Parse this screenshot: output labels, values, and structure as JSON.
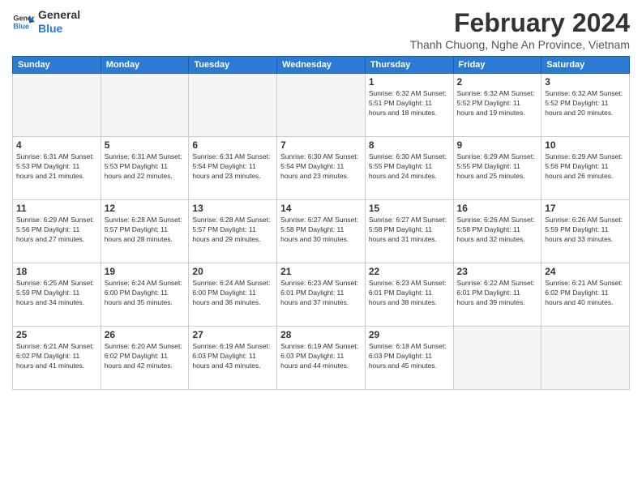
{
  "logo": {
    "line1": "General",
    "line2": "Blue"
  },
  "title": "February 2024",
  "subtitle": "Thanh Chuong, Nghe An Province, Vietnam",
  "days_of_week": [
    "Sunday",
    "Monday",
    "Tuesday",
    "Wednesday",
    "Thursday",
    "Friday",
    "Saturday"
  ],
  "weeks": [
    [
      {
        "day": "",
        "info": ""
      },
      {
        "day": "",
        "info": ""
      },
      {
        "day": "",
        "info": ""
      },
      {
        "day": "",
        "info": ""
      },
      {
        "day": "1",
        "info": "Sunrise: 6:32 AM\nSunset: 5:51 PM\nDaylight: 11 hours\nand 18 minutes."
      },
      {
        "day": "2",
        "info": "Sunrise: 6:32 AM\nSunset: 5:52 PM\nDaylight: 11 hours\nand 19 minutes."
      },
      {
        "day": "3",
        "info": "Sunrise: 6:32 AM\nSunset: 5:52 PM\nDaylight: 11 hours\nand 20 minutes."
      }
    ],
    [
      {
        "day": "4",
        "info": "Sunrise: 6:31 AM\nSunset: 5:53 PM\nDaylight: 11 hours\nand 21 minutes."
      },
      {
        "day": "5",
        "info": "Sunrise: 6:31 AM\nSunset: 5:53 PM\nDaylight: 11 hours\nand 22 minutes."
      },
      {
        "day": "6",
        "info": "Sunrise: 6:31 AM\nSunset: 5:54 PM\nDaylight: 11 hours\nand 23 minutes."
      },
      {
        "day": "7",
        "info": "Sunrise: 6:30 AM\nSunset: 5:54 PM\nDaylight: 11 hours\nand 23 minutes."
      },
      {
        "day": "8",
        "info": "Sunrise: 6:30 AM\nSunset: 5:55 PM\nDaylight: 11 hours\nand 24 minutes."
      },
      {
        "day": "9",
        "info": "Sunrise: 6:29 AM\nSunset: 5:55 PM\nDaylight: 11 hours\nand 25 minutes."
      },
      {
        "day": "10",
        "info": "Sunrise: 6:29 AM\nSunset: 5:56 PM\nDaylight: 11 hours\nand 26 minutes."
      }
    ],
    [
      {
        "day": "11",
        "info": "Sunrise: 6:29 AM\nSunset: 5:56 PM\nDaylight: 11 hours\nand 27 minutes."
      },
      {
        "day": "12",
        "info": "Sunrise: 6:28 AM\nSunset: 5:57 PM\nDaylight: 11 hours\nand 28 minutes."
      },
      {
        "day": "13",
        "info": "Sunrise: 6:28 AM\nSunset: 5:57 PM\nDaylight: 11 hours\nand 29 minutes."
      },
      {
        "day": "14",
        "info": "Sunrise: 6:27 AM\nSunset: 5:58 PM\nDaylight: 11 hours\nand 30 minutes."
      },
      {
        "day": "15",
        "info": "Sunrise: 6:27 AM\nSunset: 5:58 PM\nDaylight: 11 hours\nand 31 minutes."
      },
      {
        "day": "16",
        "info": "Sunrise: 6:26 AM\nSunset: 5:58 PM\nDaylight: 11 hours\nand 32 minutes."
      },
      {
        "day": "17",
        "info": "Sunrise: 6:26 AM\nSunset: 5:59 PM\nDaylight: 11 hours\nand 33 minutes."
      }
    ],
    [
      {
        "day": "18",
        "info": "Sunrise: 6:25 AM\nSunset: 5:59 PM\nDaylight: 11 hours\nand 34 minutes."
      },
      {
        "day": "19",
        "info": "Sunrise: 6:24 AM\nSunset: 6:00 PM\nDaylight: 11 hours\nand 35 minutes."
      },
      {
        "day": "20",
        "info": "Sunrise: 6:24 AM\nSunset: 6:00 PM\nDaylight: 11 hours\nand 36 minutes."
      },
      {
        "day": "21",
        "info": "Sunrise: 6:23 AM\nSunset: 6:01 PM\nDaylight: 11 hours\nand 37 minutes."
      },
      {
        "day": "22",
        "info": "Sunrise: 6:23 AM\nSunset: 6:01 PM\nDaylight: 11 hours\nand 38 minutes."
      },
      {
        "day": "23",
        "info": "Sunrise: 6:22 AM\nSunset: 6:01 PM\nDaylight: 11 hours\nand 39 minutes."
      },
      {
        "day": "24",
        "info": "Sunrise: 6:21 AM\nSunset: 6:02 PM\nDaylight: 11 hours\nand 40 minutes."
      }
    ],
    [
      {
        "day": "25",
        "info": "Sunrise: 6:21 AM\nSunset: 6:02 PM\nDaylight: 11 hours\nand 41 minutes."
      },
      {
        "day": "26",
        "info": "Sunrise: 6:20 AM\nSunset: 6:02 PM\nDaylight: 11 hours\nand 42 minutes."
      },
      {
        "day": "27",
        "info": "Sunrise: 6:19 AM\nSunset: 6:03 PM\nDaylight: 11 hours\nand 43 minutes."
      },
      {
        "day": "28",
        "info": "Sunrise: 6:19 AM\nSunset: 6:03 PM\nDaylight: 11 hours\nand 44 minutes."
      },
      {
        "day": "29",
        "info": "Sunrise: 6:18 AM\nSunset: 6:03 PM\nDaylight: 11 hours\nand 45 minutes."
      },
      {
        "day": "",
        "info": ""
      },
      {
        "day": "",
        "info": ""
      }
    ]
  ]
}
